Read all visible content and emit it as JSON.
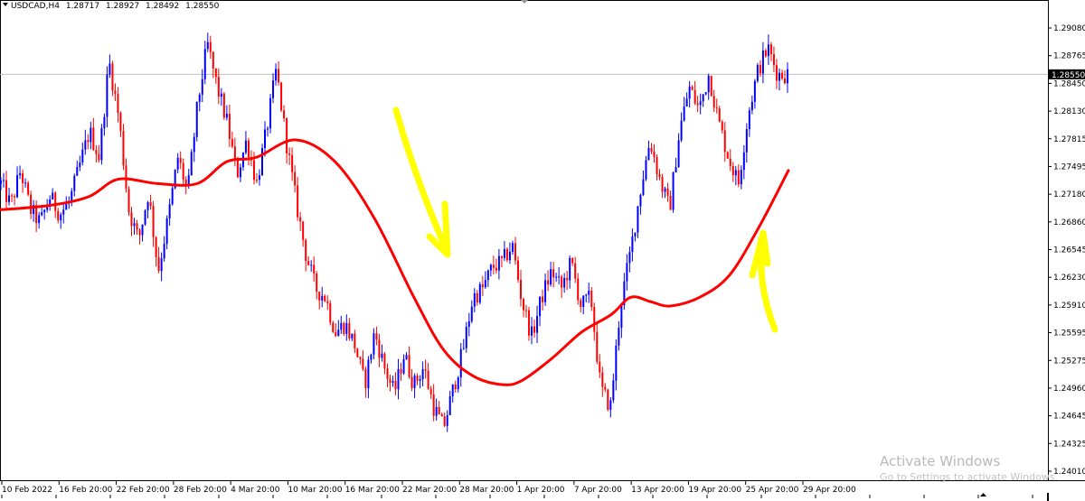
{
  "header": {
    "symbol": "USDCAD,H4",
    "open": "1.28717",
    "high": "1.28927",
    "low": "1.28492",
    "close": "1.28550"
  },
  "icons": {
    "dropdown": "triangle-down-icon",
    "scroll_marker": "triangle-up-icon"
  },
  "colors": {
    "up_bar": "#0000ff",
    "down_bar": "#ff0000",
    "moving_average": "#ff0000",
    "annotation_arrow": "#ffff00",
    "current_price_label_bg": "#000000",
    "current_price_line": "#c0c0c0"
  },
  "price_axis": {
    "labels": [
      "1.29080",
      "1.28765",
      "1.28450",
      "1.28130",
      "1.27815",
      "1.27495",
      "1.27180",
      "1.26860",
      "1.26545",
      "1.26230",
      "1.25910",
      "1.25595",
      "1.25275",
      "1.24960",
      "1.24645",
      "1.24325",
      "1.24010"
    ],
    "current_price": "1.28550"
  },
  "time_axis": {
    "labels": [
      "10 Feb 2022",
      "16 Feb 20:00",
      "22 Feb 20:00",
      "28 Feb 20:00",
      "4 Mar 20:00",
      "10 Mar 20:00",
      "16 Mar 20:00",
      "22 Mar 20:00",
      "28 Mar 20:00",
      "1 Apr 20:00",
      "7 Apr 20:00",
      "13 Apr 20:00",
      "19 Apr 20:00",
      "25 Apr 20:00",
      "29 Apr 20:00"
    ]
  },
  "watermark": {
    "title": "Activate Windows",
    "subtitle": "Go to Settings to activate Windows."
  },
  "chart_data": {
    "type": "candlestick",
    "symbol": "USDCAD",
    "timeframe": "H4",
    "ylim": [
      1.2395,
      1.2915
    ],
    "grid": false,
    "up_color": "#0000ff",
    "down_color": "#ff0000",
    "price_path": [
      [
        0,
        1.273
      ],
      [
        1,
        1.2705
      ],
      [
        2,
        1.2745
      ],
      [
        3,
        1.27
      ],
      [
        4,
        1.2685
      ],
      [
        5,
        1.2715
      ],
      [
        6,
        1.2695
      ],
      [
        7,
        1.271
      ],
      [
        8,
        1.275
      ],
      [
        9,
        1.279
      ],
      [
        10,
        1.276
      ],
      [
        11,
        1.287
      ],
      [
        12,
        1.2805
      ],
      [
        13,
        1.27
      ],
      [
        14,
        1.2665
      ],
      [
        15,
        1.272
      ],
      [
        16,
        1.263
      ],
      [
        17,
        1.269
      ],
      [
        18,
        1.276
      ],
      [
        19,
        1.272
      ],
      [
        20,
        1.282
      ],
      [
        21,
        1.289
      ],
      [
        22,
        1.284
      ],
      [
        23,
        1.28
      ],
      [
        24,
        1.274
      ],
      [
        25,
        1.278
      ],
      [
        26,
        1.273
      ],
      [
        27,
        1.279
      ],
      [
        28,
        1.286
      ],
      [
        29,
        1.278
      ],
      [
        30,
        1.271
      ],
      [
        31,
        1.265
      ],
      [
        32,
        1.261
      ],
      [
        33,
        1.26
      ],
      [
        34,
        1.256
      ],
      [
        35,
        1.257
      ],
      [
        36,
        1.2545
      ],
      [
        37,
        1.25
      ],
      [
        38,
        1.256
      ],
      [
        39,
        1.252
      ],
      [
        40,
        1.249
      ],
      [
        41,
        1.2535
      ],
      [
        42,
        1.25
      ],
      [
        43,
        1.252
      ],
      [
        44,
        1.2475
      ],
      [
        45,
        1.245
      ],
      [
        46,
        1.2495
      ],
      [
        47,
        1.254
      ],
      [
        48,
        1.26
      ],
      [
        49,
        1.261
      ],
      [
        50,
        1.2635
      ],
      [
        51,
        1.264
      ],
      [
        52,
        1.266
      ],
      [
        53,
        1.2595
      ],
      [
        54,
        1.2555
      ],
      [
        55,
        1.26
      ],
      [
        56,
        1.263
      ],
      [
        57,
        1.261
      ],
      [
        58,
        1.264
      ],
      [
        59,
        1.259
      ],
      [
        60,
        1.26
      ],
      [
        61,
        1.2495
      ],
      [
        62,
        1.2475
      ],
      [
        63,
        1.259
      ],
      [
        64,
        1.265
      ],
      [
        65,
        1.272
      ],
      [
        66,
        1.278
      ],
      [
        67,
        1.2735
      ],
      [
        68,
        1.27
      ],
      [
        69,
        1.279
      ],
      [
        70,
        1.284
      ],
      [
        71,
        1.2815
      ],
      [
        72,
        1.2855
      ],
      [
        73,
        1.28
      ],
      [
        74,
        1.276
      ],
      [
        75,
        1.273
      ],
      [
        76,
        1.281
      ],
      [
        77,
        1.286
      ],
      [
        78,
        1.2885
      ],
      [
        79,
        1.2855
      ],
      [
        80,
        1.2855
      ]
    ],
    "moving_average": [
      [
        0,
        1.27
      ],
      [
        5,
        1.2705
      ],
      [
        9,
        1.2715
      ],
      [
        12,
        1.2735
      ],
      [
        16,
        1.273
      ],
      [
        20,
        1.273
      ],
      [
        23,
        1.2755
      ],
      [
        26,
        1.276
      ],
      [
        30,
        1.278
      ],
      [
        34,
        1.2755
      ],
      [
        38,
        1.269
      ],
      [
        42,
        1.26
      ],
      [
        45,
        1.254
      ],
      [
        48,
        1.251
      ],
      [
        51,
        1.25
      ],
      [
        53,
        1.2505
      ],
      [
        56,
        1.253
      ],
      [
        59,
        1.256
      ],
      [
        62,
        1.258
      ],
      [
        64,
        1.26
      ],
      [
        66,
        1.2595
      ],
      [
        68,
        1.259
      ],
      [
        71,
        1.26
      ],
      [
        74,
        1.2625
      ],
      [
        77,
        1.268
      ],
      [
        80,
        1.2745
      ]
    ],
    "annotations": [
      {
        "type": "arrow",
        "direction": "down",
        "color": "#ffff00"
      },
      {
        "type": "arrow",
        "direction": "up",
        "color": "#ffff00"
      }
    ]
  }
}
